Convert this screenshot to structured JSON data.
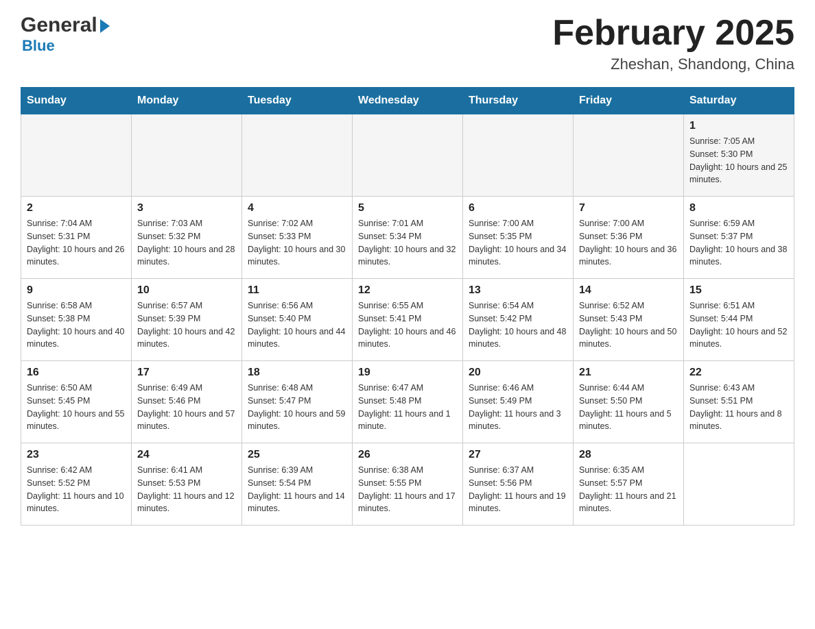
{
  "header": {
    "logo_general": "General",
    "logo_blue": "Blue",
    "title": "February 2025",
    "subtitle": "Zheshan, Shandong, China"
  },
  "days_of_week": [
    "Sunday",
    "Monday",
    "Tuesday",
    "Wednesday",
    "Thursday",
    "Friday",
    "Saturday"
  ],
  "weeks": [
    [
      {
        "day": "",
        "info": ""
      },
      {
        "day": "",
        "info": ""
      },
      {
        "day": "",
        "info": ""
      },
      {
        "day": "",
        "info": ""
      },
      {
        "day": "",
        "info": ""
      },
      {
        "day": "",
        "info": ""
      },
      {
        "day": "1",
        "info": "Sunrise: 7:05 AM\nSunset: 5:30 PM\nDaylight: 10 hours and 25 minutes."
      }
    ],
    [
      {
        "day": "2",
        "info": "Sunrise: 7:04 AM\nSunset: 5:31 PM\nDaylight: 10 hours and 26 minutes."
      },
      {
        "day": "3",
        "info": "Sunrise: 7:03 AM\nSunset: 5:32 PM\nDaylight: 10 hours and 28 minutes."
      },
      {
        "day": "4",
        "info": "Sunrise: 7:02 AM\nSunset: 5:33 PM\nDaylight: 10 hours and 30 minutes."
      },
      {
        "day": "5",
        "info": "Sunrise: 7:01 AM\nSunset: 5:34 PM\nDaylight: 10 hours and 32 minutes."
      },
      {
        "day": "6",
        "info": "Sunrise: 7:00 AM\nSunset: 5:35 PM\nDaylight: 10 hours and 34 minutes."
      },
      {
        "day": "7",
        "info": "Sunrise: 7:00 AM\nSunset: 5:36 PM\nDaylight: 10 hours and 36 minutes."
      },
      {
        "day": "8",
        "info": "Sunrise: 6:59 AM\nSunset: 5:37 PM\nDaylight: 10 hours and 38 minutes."
      }
    ],
    [
      {
        "day": "9",
        "info": "Sunrise: 6:58 AM\nSunset: 5:38 PM\nDaylight: 10 hours and 40 minutes."
      },
      {
        "day": "10",
        "info": "Sunrise: 6:57 AM\nSunset: 5:39 PM\nDaylight: 10 hours and 42 minutes."
      },
      {
        "day": "11",
        "info": "Sunrise: 6:56 AM\nSunset: 5:40 PM\nDaylight: 10 hours and 44 minutes."
      },
      {
        "day": "12",
        "info": "Sunrise: 6:55 AM\nSunset: 5:41 PM\nDaylight: 10 hours and 46 minutes."
      },
      {
        "day": "13",
        "info": "Sunrise: 6:54 AM\nSunset: 5:42 PM\nDaylight: 10 hours and 48 minutes."
      },
      {
        "day": "14",
        "info": "Sunrise: 6:52 AM\nSunset: 5:43 PM\nDaylight: 10 hours and 50 minutes."
      },
      {
        "day": "15",
        "info": "Sunrise: 6:51 AM\nSunset: 5:44 PM\nDaylight: 10 hours and 52 minutes."
      }
    ],
    [
      {
        "day": "16",
        "info": "Sunrise: 6:50 AM\nSunset: 5:45 PM\nDaylight: 10 hours and 55 minutes."
      },
      {
        "day": "17",
        "info": "Sunrise: 6:49 AM\nSunset: 5:46 PM\nDaylight: 10 hours and 57 minutes."
      },
      {
        "day": "18",
        "info": "Sunrise: 6:48 AM\nSunset: 5:47 PM\nDaylight: 10 hours and 59 minutes."
      },
      {
        "day": "19",
        "info": "Sunrise: 6:47 AM\nSunset: 5:48 PM\nDaylight: 11 hours and 1 minute."
      },
      {
        "day": "20",
        "info": "Sunrise: 6:46 AM\nSunset: 5:49 PM\nDaylight: 11 hours and 3 minutes."
      },
      {
        "day": "21",
        "info": "Sunrise: 6:44 AM\nSunset: 5:50 PM\nDaylight: 11 hours and 5 minutes."
      },
      {
        "day": "22",
        "info": "Sunrise: 6:43 AM\nSunset: 5:51 PM\nDaylight: 11 hours and 8 minutes."
      }
    ],
    [
      {
        "day": "23",
        "info": "Sunrise: 6:42 AM\nSunset: 5:52 PM\nDaylight: 11 hours and 10 minutes."
      },
      {
        "day": "24",
        "info": "Sunrise: 6:41 AM\nSunset: 5:53 PM\nDaylight: 11 hours and 12 minutes."
      },
      {
        "day": "25",
        "info": "Sunrise: 6:39 AM\nSunset: 5:54 PM\nDaylight: 11 hours and 14 minutes."
      },
      {
        "day": "26",
        "info": "Sunrise: 6:38 AM\nSunset: 5:55 PM\nDaylight: 11 hours and 17 minutes."
      },
      {
        "day": "27",
        "info": "Sunrise: 6:37 AM\nSunset: 5:56 PM\nDaylight: 11 hours and 19 minutes."
      },
      {
        "day": "28",
        "info": "Sunrise: 6:35 AM\nSunset: 5:57 PM\nDaylight: 11 hours and 21 minutes."
      },
      {
        "day": "",
        "info": ""
      }
    ]
  ]
}
